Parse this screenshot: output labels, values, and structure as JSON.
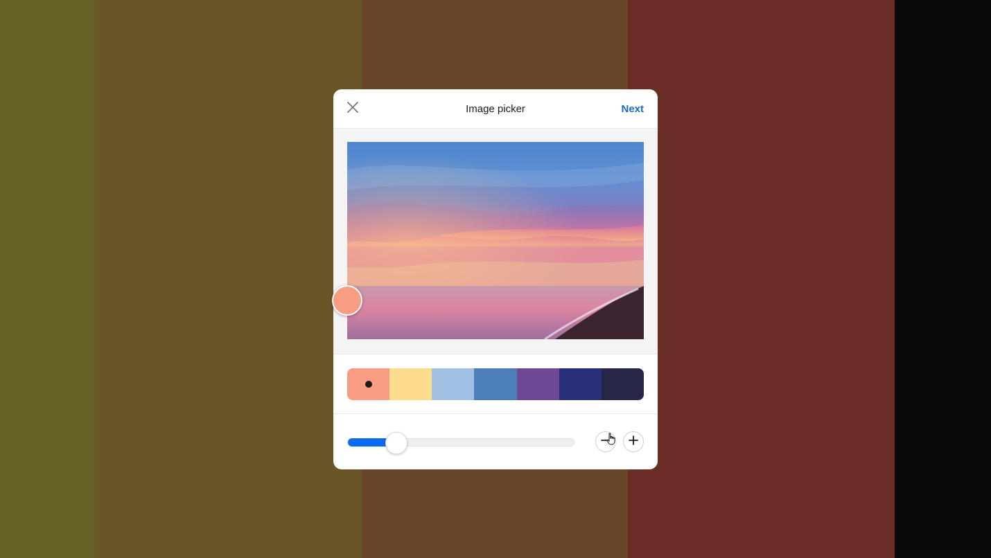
{
  "background": {
    "strip_colors": [
      "#646127",
      "#6a5526",
      "#694529",
      "#692d25",
      "#0a0a0a"
    ]
  },
  "dialog": {
    "title": "Image picker",
    "close_icon": "close-icon",
    "next_label": "Next"
  },
  "picker": {
    "selected_color": "#f89c84"
  },
  "palette": {
    "colors": [
      "#f89c84",
      "#fddc8e",
      "#a0bfe3",
      "#4c7fb8",
      "#6c4992",
      "#272f78",
      "#262747"
    ],
    "selected_index": 0
  },
  "zoom": {
    "level_fraction": 0.21,
    "minus_icon": "minus-icon",
    "plus_icon": "plus-icon"
  },
  "cursor": "pointer-hand-icon"
}
